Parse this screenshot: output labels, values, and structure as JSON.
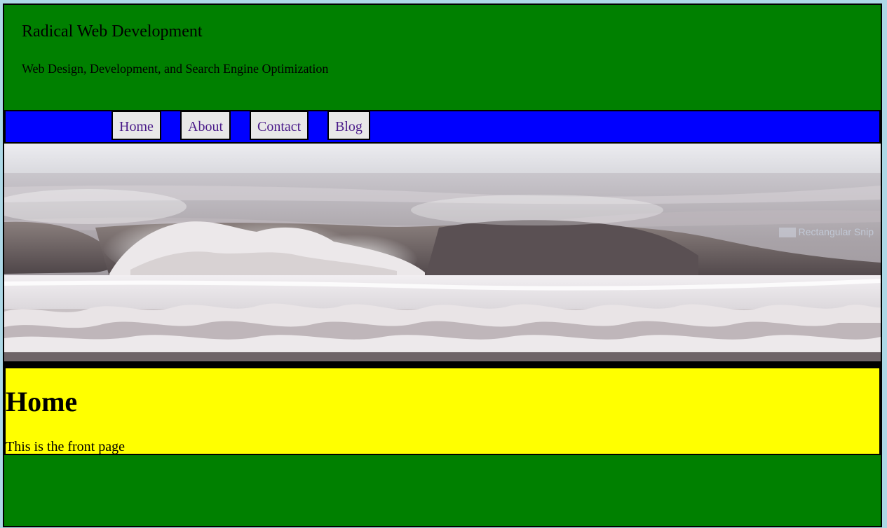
{
  "header": {
    "title": "Radical Web Development",
    "tagline": "Web Design, Development, and Search Engine Optimization"
  },
  "nav": {
    "items": [
      {
        "label": "Home"
      },
      {
        "label": "About"
      },
      {
        "label": "Contact"
      },
      {
        "label": "Blog"
      }
    ]
  },
  "hero": {
    "image": "ocean-waves-photo",
    "caption": "Rectangular Snip"
  },
  "main": {
    "heading": "Home",
    "text": "This is the front page"
  },
  "colors": {
    "page_background": "#add8e6",
    "header_background": "#008000",
    "nav_background": "#0000ff",
    "nav_item_background": "#e8e8e8",
    "nav_link": "#4b1c8a",
    "content_background": "#ffff00",
    "border": "#000000"
  }
}
